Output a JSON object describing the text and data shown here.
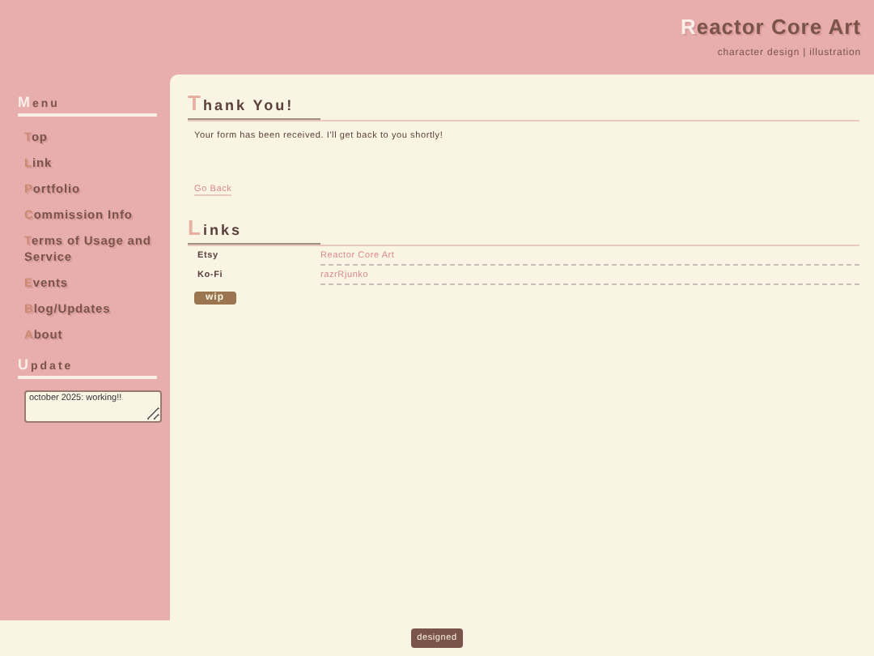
{
  "header": {
    "title": "Reactor Core Art",
    "subtitle": "character design | illustration"
  },
  "sidebar": {
    "menu_title": "Menu",
    "items": [
      {
        "label": "Top"
      },
      {
        "label": "Link"
      },
      {
        "label": "Portfolio"
      },
      {
        "label": "Commission Info"
      },
      {
        "label": "Terms of Usage and Service"
      },
      {
        "label": "Events"
      },
      {
        "label": "Blog/Updates"
      },
      {
        "label": "About"
      }
    ],
    "update_title": "Update",
    "update_text": "october 2025: working!!"
  },
  "main": {
    "thank_title": "Thank You!",
    "message": "Your form has been received. I'll get back to you shortly!",
    "back_link": "Go Back",
    "links_title": "Links",
    "links": [
      {
        "site": "Etsy",
        "name": "Reactor Core Art"
      },
      {
        "site": "Ko-Fi",
        "name": "razrRjunko"
      }
    ],
    "wip_badge": "wip"
  },
  "footer": {
    "badge": "designed"
  }
}
